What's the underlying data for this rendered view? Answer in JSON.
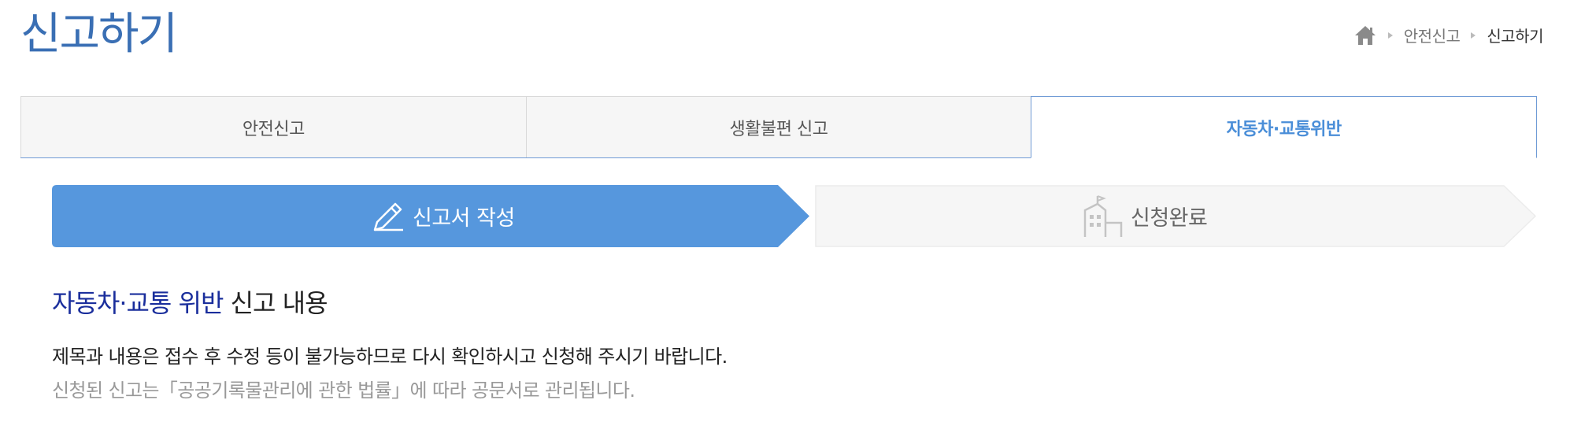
{
  "page": {
    "title": "신고하기"
  },
  "breadcrumb": {
    "home_icon": "home-icon",
    "items": [
      "안전신고",
      "신고하기"
    ]
  },
  "tabs": [
    {
      "label": "안전신고",
      "active": false
    },
    {
      "label": "생활불편 신고",
      "active": false
    },
    {
      "label": "자동차·교통위반",
      "active": true
    }
  ],
  "steps": [
    {
      "label": "신고서 작성",
      "icon": "pencil-icon",
      "active": true
    },
    {
      "label": "신청완료",
      "icon": "building-icon",
      "active": false
    }
  ],
  "section": {
    "title_highlight": "자동차·교통 위반",
    "title_rest": " 신고 내용"
  },
  "notices": {
    "line1": "제목과 내용은 접수 후 수정 등이 불가능하므로 다시 확인하시고 신청해 주시기 바랍니다.",
    "line2": "신청된 신고는「공공기록물관리에 관한 법률」에 따라 공문서로 관리됩니다."
  },
  "colors": {
    "title": "#3a6fb4",
    "active_tab": "#4a8ed8",
    "active_step": "#5697dd",
    "inactive_step": "#f6f6f6",
    "section_highlight": "#1a2e9c"
  }
}
